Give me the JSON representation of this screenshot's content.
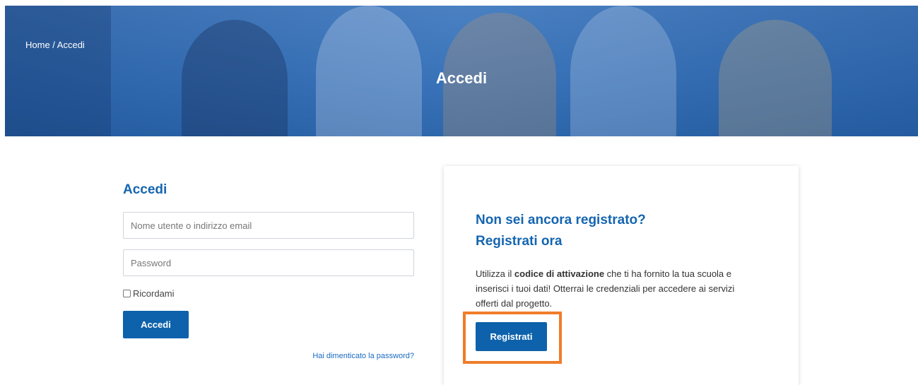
{
  "hero": {
    "breadcrumb": "Home / Accedi",
    "title": "Accedi"
  },
  "login": {
    "title": "Accedi",
    "username_placeholder": "Nome utente o indirizzo email",
    "password_placeholder": "Password",
    "remember_label": "Ricordami",
    "submit_label": "Accedi",
    "forgot_link": "Hai dimenticato la password?"
  },
  "register": {
    "title_line1": "Non sei ancora registrato?",
    "title_line2": "Registrati ora",
    "text_before": "Utilizza il ",
    "text_bold": "codice di attivazione",
    "text_after": " che ti ha fornito la tua scuola e inserisci i tuoi dati! Otterrai le credenziali per accedere ai servizi offerti dal progetto.",
    "button_label": "Registrati"
  },
  "colors": {
    "brand_blue": "#0d62ab",
    "highlight_orange": "#ef7d2a"
  }
}
